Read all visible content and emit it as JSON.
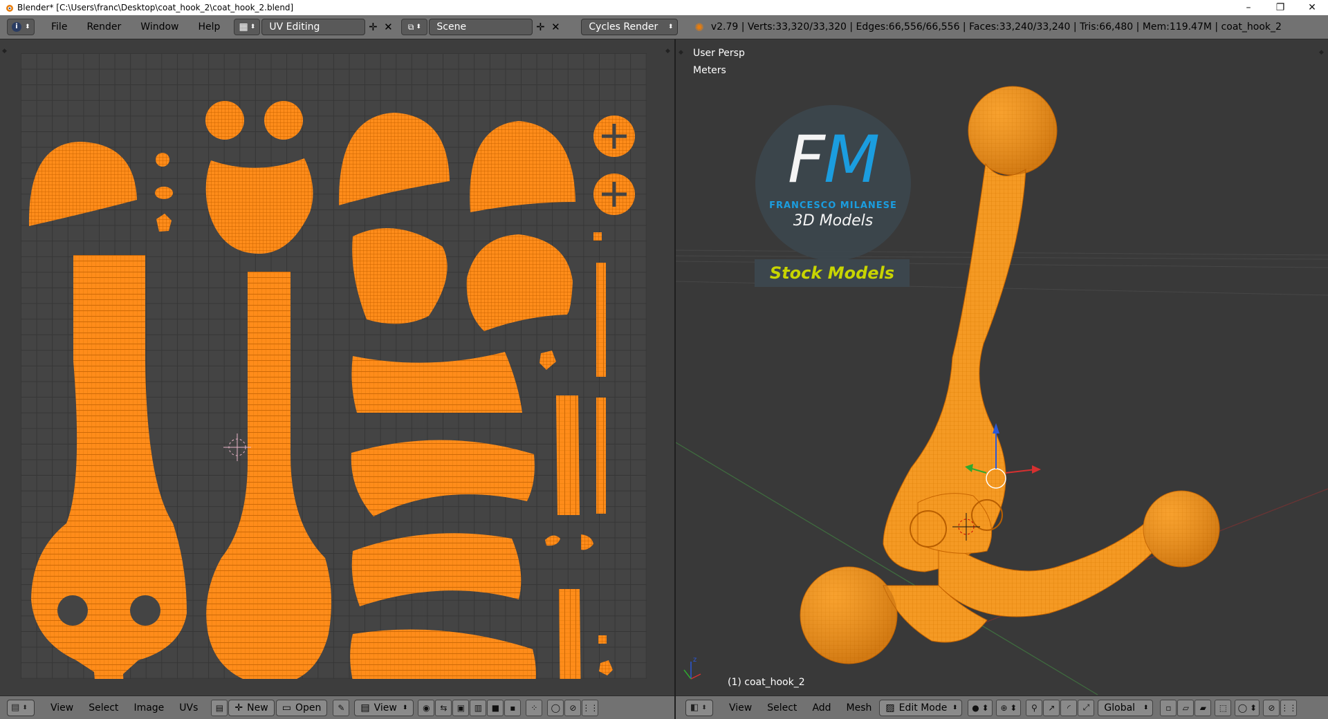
{
  "window": {
    "title": "Blender* [C:\\Users\\franc\\Desktop\\coat_hook_2\\coat_hook_2.blend]",
    "controls": [
      "–",
      "❐",
      "✕"
    ]
  },
  "info_header": {
    "menus": [
      "File",
      "Render",
      "Window",
      "Help"
    ],
    "screen_layout": "UV Editing",
    "scene": "Scene",
    "render_engine": "Cycles Render",
    "stats": "v2.79 | Verts:33,320/33,320 | Edges:66,556/66,556 | Faces:33,240/33,240 | Tris:66,480 | Mem:119.47M | coat_hook_2"
  },
  "uv_editor": {
    "menus": [
      "View",
      "Select",
      "Image",
      "UVs"
    ],
    "new_label": "New",
    "open_label": "Open",
    "view_label": "View"
  },
  "viewport": {
    "view_label": "User Persp",
    "units_label": "Meters",
    "object_label": "(1) coat_hook_2",
    "menus": [
      "View",
      "Select",
      "Add",
      "Mesh"
    ],
    "mode": "Edit Mode",
    "orientation": "Global"
  },
  "watermark": {
    "initials": "FM",
    "name": "FRANCESCO MILANESE",
    "tagline": "3D Models",
    "badge": "Stock Models"
  },
  "colors": {
    "mesh": "#ff8c1a",
    "mesh_dark": "#d06800",
    "header": "#727272",
    "editor_bg": "#3d3d3d",
    "watermark_blue": "#1aa3e8",
    "badge_yellow": "#c8d400"
  }
}
